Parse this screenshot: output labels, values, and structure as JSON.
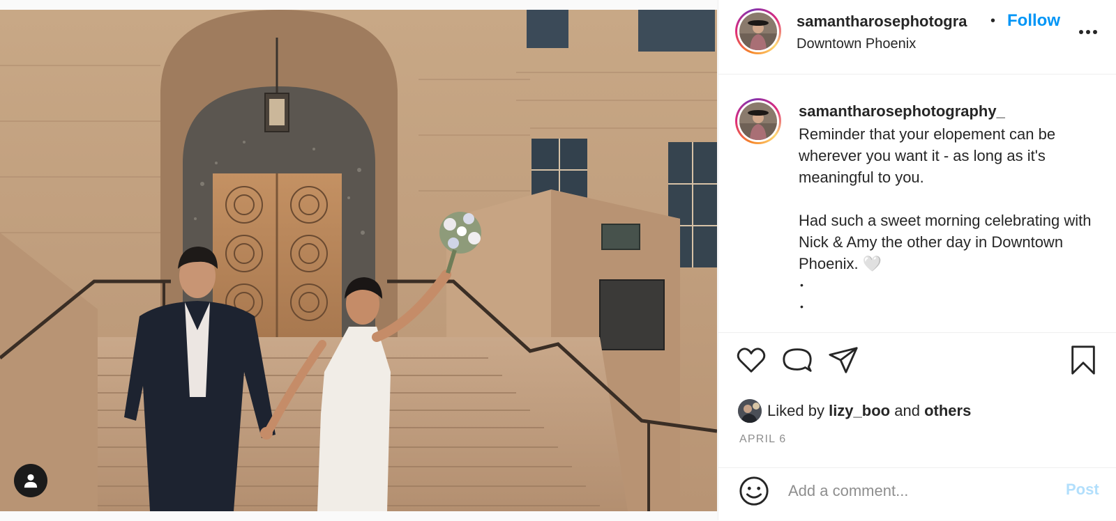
{
  "post": {
    "username_short": "samantharosephotogra",
    "separator": "•",
    "follow_label": "Follow",
    "location": "Downtown Phoenix",
    "more_icon": "more-horizontal-icon"
  },
  "caption": {
    "username": "samantharosephotography_",
    "line1": "Reminder that your elopement can be wherever you want it - as long as it's meaningful to you.",
    "line2": "Had such a sweet morning celebrating with Nick & Amy the other day in Downtown Phoenix. 🤍",
    "dot1": "•",
    "dot2": "•"
  },
  "actions": {
    "like_icon": "heart-icon",
    "comment_icon": "comment-icon",
    "share_icon": "share-icon",
    "save_icon": "bookmark-icon"
  },
  "likes": {
    "prefix": "Liked by",
    "user": "lizy_boo",
    "and": "and",
    "others": "others"
  },
  "date": "APRIL 6",
  "comment": {
    "placeholder": "Add a comment...",
    "post_label": "Post"
  },
  "colors": {
    "accent": "#0095f6",
    "post_disabled": "#b2dffc",
    "muted": "#8e8e8e"
  }
}
